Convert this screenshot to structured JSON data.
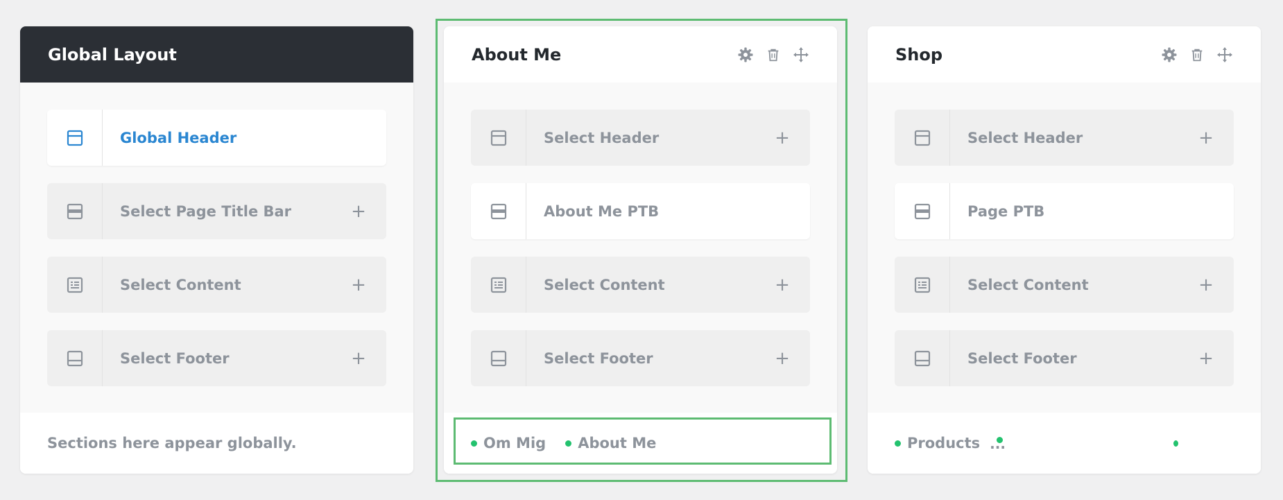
{
  "colors": {
    "page_bg": "#f0f0f1",
    "dark_header": "#2b2f35",
    "accent_blue": "#2a86d1",
    "selection_green": "#5dbb72",
    "status_dot": "#23c26e",
    "muted_text": "#8d939b"
  },
  "global_layout": {
    "title": "Global Layout",
    "slots": [
      {
        "label": "Global Header",
        "icon": "header-layout-icon",
        "state": "assigned"
      },
      {
        "label": "Select Page Title Bar",
        "icon": "page-title-bar-icon",
        "action": "+"
      },
      {
        "label": "Select Content",
        "icon": "content-layout-icon",
        "action": "+"
      },
      {
        "label": "Select Footer",
        "icon": "footer-layout-icon",
        "action": "+"
      }
    ],
    "footer_note": "Sections here appear globally."
  },
  "about_me": {
    "title": "About Me",
    "actions": [
      "gear-icon",
      "trash-icon",
      "move-icon"
    ],
    "slots": [
      {
        "label": "Select Header",
        "icon": "header-layout-icon",
        "action": "+"
      },
      {
        "label": "About Me PTB",
        "icon": "page-title-bar-icon",
        "state": "assigned"
      },
      {
        "label": "Select Content",
        "icon": "content-layout-icon",
        "action": "+"
      },
      {
        "label": "Select Footer",
        "icon": "footer-layout-icon",
        "action": "+"
      }
    ],
    "conditions": [
      "Om Mig",
      "About Me"
    ]
  },
  "shop": {
    "title": "Shop",
    "actions": [
      "gear-icon",
      "trash-icon",
      "move-icon"
    ],
    "slots": [
      {
        "label": "Select Header",
        "icon": "header-layout-icon",
        "action": "+"
      },
      {
        "label": "Page PTB",
        "icon": "page-title-bar-icon",
        "state": "assigned"
      },
      {
        "label": "Select Content",
        "icon": "content-layout-icon",
        "action": "+"
      },
      {
        "label": "Select Footer",
        "icon": "footer-layout-icon",
        "action": "+"
      }
    ],
    "conditions": [
      "Products"
    ],
    "more_indicator": "..."
  }
}
